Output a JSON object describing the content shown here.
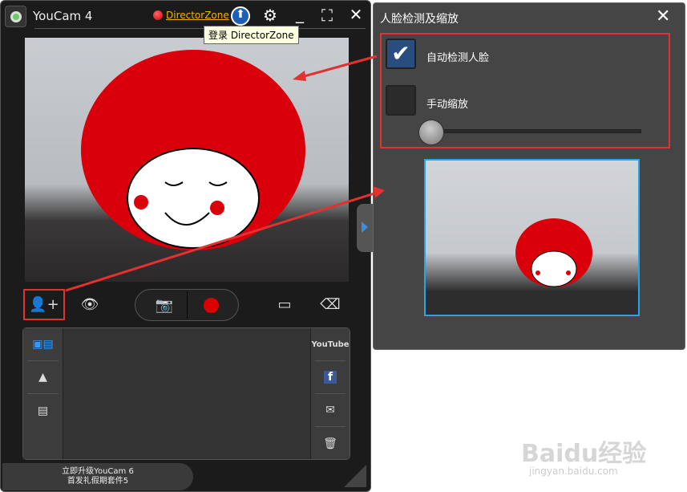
{
  "main": {
    "title": "YouCam 4",
    "director_zone": "DirectorZone",
    "tooltip": "登录 DirectorZone",
    "upgrade_line1": "立即升级YouCam 6",
    "upgrade_line2": "首发礼假期套件5"
  },
  "panel": {
    "title": "人脸检测及缩放",
    "auto_detect_label": "自动检测人脸",
    "auto_detect_checked": true,
    "manual_zoom_label": "手动缩放",
    "manual_zoom_checked": false,
    "zoom_level": 0
  },
  "share": {
    "youtube": "YouTube"
  },
  "watermark": {
    "brand": "Baidu经验",
    "url": "jingyan.baidu.com"
  },
  "colors": {
    "accent_red": "#e53030",
    "highlight_blue": "#2aa3e8"
  }
}
